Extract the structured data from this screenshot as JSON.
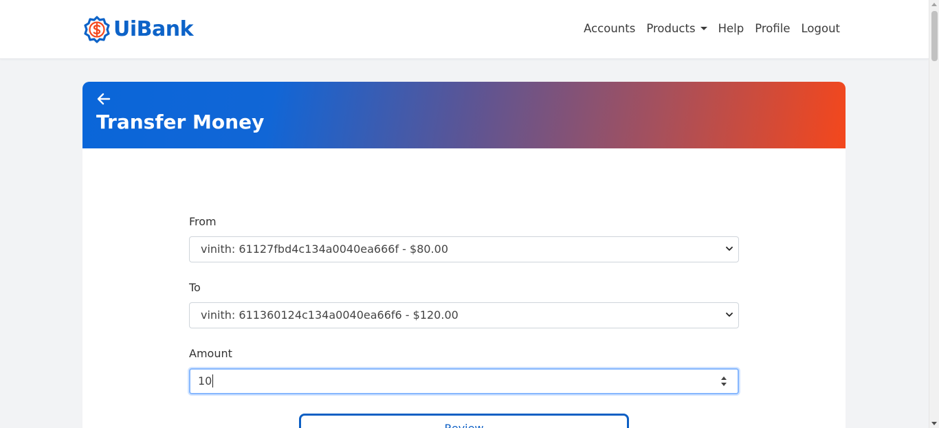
{
  "brand": {
    "name": "UiBank",
    "logo_icon": "dollar-badge-icon",
    "color": "#0d63c8",
    "accent": "#f4471c"
  },
  "nav": {
    "items": [
      {
        "label": "Accounts"
      },
      {
        "label": "Products",
        "has_dropdown": true
      },
      {
        "label": "Help"
      },
      {
        "label": "Profile"
      },
      {
        "label": "Logout"
      }
    ]
  },
  "card": {
    "title": "Transfer Money",
    "back_icon": "arrow-left-icon",
    "gradient": [
      "#0a66d9",
      "#f4471c"
    ]
  },
  "form": {
    "from": {
      "label": "From",
      "value": "vinith: 61127fbd4c134a0040ea666f - $80.00"
    },
    "to": {
      "label": "To",
      "value": "vinith: 611360124c134a0040ea66f6 - $120.00"
    },
    "amount": {
      "label": "Amount",
      "value": "10"
    },
    "review_label": "Review"
  }
}
